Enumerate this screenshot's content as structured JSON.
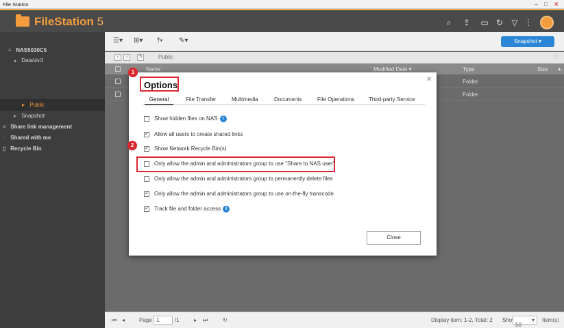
{
  "window": {
    "title": "File Station"
  },
  "app": {
    "brand_name": "FileStation",
    "brand_version": "5"
  },
  "header_icons": [
    "search-icon",
    "share-icon",
    "monitor-icon",
    "refresh-icon",
    "filter-icon",
    "more-icon"
  ],
  "sidebar": {
    "items": [
      {
        "label": "NAS5030C5",
        "icon": "server-icon"
      },
      {
        "label": "DataVol1",
        "icon": "drive-icon"
      },
      {
        "label": "Public",
        "icon": "folder-icon"
      },
      {
        "label": "Snapshot",
        "icon": "snapshot-icon"
      },
      {
        "label": "Share link management",
        "icon": "share-link-icon"
      },
      {
        "label": "Shared with me",
        "icon": "shared-icon"
      },
      {
        "label": "Recycle Bin",
        "icon": "trash-icon"
      }
    ]
  },
  "toolbar": {
    "snapshot_label": "Snapshot ▾"
  },
  "pathbar": {
    "path": "Public"
  },
  "grid": {
    "columns": [
      "Name",
      "Modified Date ▾",
      "Type",
      "Size"
    ],
    "rows": [
      {
        "type": "Folder"
      },
      {
        "type": "Folder"
      }
    ]
  },
  "statusbar": {
    "page_label": "Page",
    "page_value": "1",
    "page_total": "/1",
    "display_info": "Display item: 1-2, Total: 2",
    "show_label": "Show",
    "show_value": "50",
    "items_label": "Item(s)"
  },
  "dialog": {
    "title": "Options",
    "tabs": [
      "General",
      "File Transfer",
      "Multimedia",
      "Documents",
      "File Operations",
      "Third-party Service"
    ],
    "active_tab": "General",
    "options": [
      {
        "label": "Show hidden files on NAS",
        "checked": false,
        "info": true
      },
      {
        "label": "Allow all users to create shared links",
        "checked": true,
        "info": false
      },
      {
        "label": "Show Network Recycle Bin(s)",
        "checked": true,
        "info": false
      },
      {
        "label": "Only allow the admin and administrators group to use \"Share to NAS user\"",
        "checked": false,
        "info": false
      },
      {
        "label": "Only allow the admin and administrators group to permanently delete files",
        "checked": false,
        "info": false
      },
      {
        "label": "Only allow the admin and administrators group to use on-the-fly transcode",
        "checked": true,
        "info": false
      },
      {
        "label": "Track file and folder access",
        "checked": true,
        "info": true
      }
    ],
    "close_label": "Close",
    "callouts": [
      "1",
      "2"
    ]
  },
  "colors": {
    "accent": "#f39c3d",
    "highlight": "#d9262f",
    "primary_button": "#2c86d6"
  }
}
